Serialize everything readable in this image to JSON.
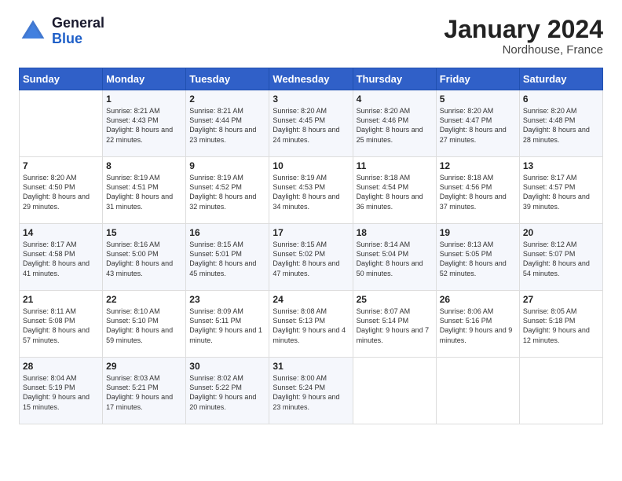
{
  "header": {
    "logo_general": "General",
    "logo_blue": "Blue",
    "month_title": "January 2024",
    "location": "Nordhouse, France"
  },
  "days_of_week": [
    "Sunday",
    "Monday",
    "Tuesday",
    "Wednesday",
    "Thursday",
    "Friday",
    "Saturday"
  ],
  "weeks": [
    [
      {
        "day": "",
        "sunrise": "",
        "sunset": "",
        "daylight": ""
      },
      {
        "day": "1",
        "sunrise": "Sunrise: 8:21 AM",
        "sunset": "Sunset: 4:43 PM",
        "daylight": "Daylight: 8 hours and 22 minutes."
      },
      {
        "day": "2",
        "sunrise": "Sunrise: 8:21 AM",
        "sunset": "Sunset: 4:44 PM",
        "daylight": "Daylight: 8 hours and 23 minutes."
      },
      {
        "day": "3",
        "sunrise": "Sunrise: 8:20 AM",
        "sunset": "Sunset: 4:45 PM",
        "daylight": "Daylight: 8 hours and 24 minutes."
      },
      {
        "day": "4",
        "sunrise": "Sunrise: 8:20 AM",
        "sunset": "Sunset: 4:46 PM",
        "daylight": "Daylight: 8 hours and 25 minutes."
      },
      {
        "day": "5",
        "sunrise": "Sunrise: 8:20 AM",
        "sunset": "Sunset: 4:47 PM",
        "daylight": "Daylight: 8 hours and 27 minutes."
      },
      {
        "day": "6",
        "sunrise": "Sunrise: 8:20 AM",
        "sunset": "Sunset: 4:48 PM",
        "daylight": "Daylight: 8 hours and 28 minutes."
      }
    ],
    [
      {
        "day": "7",
        "sunrise": "Sunrise: 8:20 AM",
        "sunset": "Sunset: 4:50 PM",
        "daylight": "Daylight: 8 hours and 29 minutes."
      },
      {
        "day": "8",
        "sunrise": "Sunrise: 8:19 AM",
        "sunset": "Sunset: 4:51 PM",
        "daylight": "Daylight: 8 hours and 31 minutes."
      },
      {
        "day": "9",
        "sunrise": "Sunrise: 8:19 AM",
        "sunset": "Sunset: 4:52 PM",
        "daylight": "Daylight: 8 hours and 32 minutes."
      },
      {
        "day": "10",
        "sunrise": "Sunrise: 8:19 AM",
        "sunset": "Sunset: 4:53 PM",
        "daylight": "Daylight: 8 hours and 34 minutes."
      },
      {
        "day": "11",
        "sunrise": "Sunrise: 8:18 AM",
        "sunset": "Sunset: 4:54 PM",
        "daylight": "Daylight: 8 hours and 36 minutes."
      },
      {
        "day": "12",
        "sunrise": "Sunrise: 8:18 AM",
        "sunset": "Sunset: 4:56 PM",
        "daylight": "Daylight: 8 hours and 37 minutes."
      },
      {
        "day": "13",
        "sunrise": "Sunrise: 8:17 AM",
        "sunset": "Sunset: 4:57 PM",
        "daylight": "Daylight: 8 hours and 39 minutes."
      }
    ],
    [
      {
        "day": "14",
        "sunrise": "Sunrise: 8:17 AM",
        "sunset": "Sunset: 4:58 PM",
        "daylight": "Daylight: 8 hours and 41 minutes."
      },
      {
        "day": "15",
        "sunrise": "Sunrise: 8:16 AM",
        "sunset": "Sunset: 5:00 PM",
        "daylight": "Daylight: 8 hours and 43 minutes."
      },
      {
        "day": "16",
        "sunrise": "Sunrise: 8:15 AM",
        "sunset": "Sunset: 5:01 PM",
        "daylight": "Daylight: 8 hours and 45 minutes."
      },
      {
        "day": "17",
        "sunrise": "Sunrise: 8:15 AM",
        "sunset": "Sunset: 5:02 PM",
        "daylight": "Daylight: 8 hours and 47 minutes."
      },
      {
        "day": "18",
        "sunrise": "Sunrise: 8:14 AM",
        "sunset": "Sunset: 5:04 PM",
        "daylight": "Daylight: 8 hours and 50 minutes."
      },
      {
        "day": "19",
        "sunrise": "Sunrise: 8:13 AM",
        "sunset": "Sunset: 5:05 PM",
        "daylight": "Daylight: 8 hours and 52 minutes."
      },
      {
        "day": "20",
        "sunrise": "Sunrise: 8:12 AM",
        "sunset": "Sunset: 5:07 PM",
        "daylight": "Daylight: 8 hours and 54 minutes."
      }
    ],
    [
      {
        "day": "21",
        "sunrise": "Sunrise: 8:11 AM",
        "sunset": "Sunset: 5:08 PM",
        "daylight": "Daylight: 8 hours and 57 minutes."
      },
      {
        "day": "22",
        "sunrise": "Sunrise: 8:10 AM",
        "sunset": "Sunset: 5:10 PM",
        "daylight": "Daylight: 8 hours and 59 minutes."
      },
      {
        "day": "23",
        "sunrise": "Sunrise: 8:09 AM",
        "sunset": "Sunset: 5:11 PM",
        "daylight": "Daylight: 9 hours and 1 minute."
      },
      {
        "day": "24",
        "sunrise": "Sunrise: 8:08 AM",
        "sunset": "Sunset: 5:13 PM",
        "daylight": "Daylight: 9 hours and 4 minutes."
      },
      {
        "day": "25",
        "sunrise": "Sunrise: 8:07 AM",
        "sunset": "Sunset: 5:14 PM",
        "daylight": "Daylight: 9 hours and 7 minutes."
      },
      {
        "day": "26",
        "sunrise": "Sunrise: 8:06 AM",
        "sunset": "Sunset: 5:16 PM",
        "daylight": "Daylight: 9 hours and 9 minutes."
      },
      {
        "day": "27",
        "sunrise": "Sunrise: 8:05 AM",
        "sunset": "Sunset: 5:18 PM",
        "daylight": "Daylight: 9 hours and 12 minutes."
      }
    ],
    [
      {
        "day": "28",
        "sunrise": "Sunrise: 8:04 AM",
        "sunset": "Sunset: 5:19 PM",
        "daylight": "Daylight: 9 hours and 15 minutes."
      },
      {
        "day": "29",
        "sunrise": "Sunrise: 8:03 AM",
        "sunset": "Sunset: 5:21 PM",
        "daylight": "Daylight: 9 hours and 17 minutes."
      },
      {
        "day": "30",
        "sunrise": "Sunrise: 8:02 AM",
        "sunset": "Sunset: 5:22 PM",
        "daylight": "Daylight: 9 hours and 20 minutes."
      },
      {
        "day": "31",
        "sunrise": "Sunrise: 8:00 AM",
        "sunset": "Sunset: 5:24 PM",
        "daylight": "Daylight: 9 hours and 23 minutes."
      },
      {
        "day": "",
        "sunrise": "",
        "sunset": "",
        "daylight": ""
      },
      {
        "day": "",
        "sunrise": "",
        "sunset": "",
        "daylight": ""
      },
      {
        "day": "",
        "sunrise": "",
        "sunset": "",
        "daylight": ""
      }
    ]
  ]
}
